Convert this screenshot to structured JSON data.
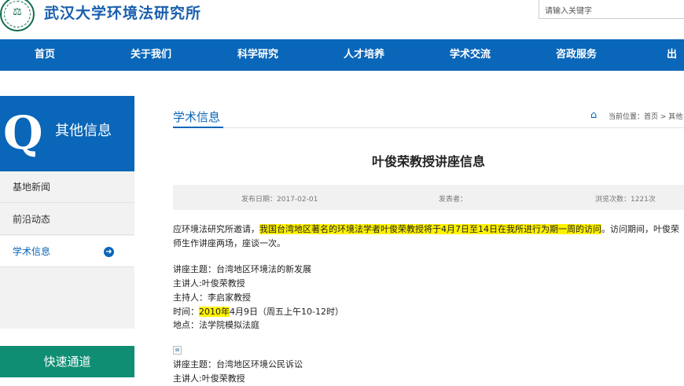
{
  "header": {
    "site_title": "武汉大学环境法研究所",
    "search_placeholder": "请输入关键字",
    "logo_icon": "university-seal-icon"
  },
  "nav": {
    "items": [
      "首页",
      "关于我们",
      "科学研究",
      "人才培养",
      "学术交流",
      "咨政服务",
      "出版"
    ]
  },
  "sidebar": {
    "head_letter": "Q",
    "title": "其他信息",
    "items": [
      {
        "label": "基地新闻",
        "active": false
      },
      {
        "label": "前沿动态",
        "active": false
      },
      {
        "label": "学术信息",
        "active": true
      }
    ],
    "quick_title": "快速通道"
  },
  "main": {
    "section_title": "学术信息",
    "breadcrumb": "当前位置：首页 > 其他",
    "article_title": "叶俊荣教授讲座信息",
    "meta": {
      "date": "发布日期：2017-02-01",
      "author": "发表者：",
      "views": "浏览次数：1221次"
    },
    "intro_a": "应环境法研究所邀请，",
    "intro_b": "我国台湾地区著名的环境法学者叶俊荣教授将于4月7日至14日在我所进行为期一周的访问",
    "intro_c": "。访问期间，叶俊荣",
    "intro_line2": "师生作讲座两场，座谈一次。",
    "lecture1": {
      "topic": "讲座主题：台湾地区环境法的新发展",
      "speaker": "主讲人:叶俊荣教授",
      "host": "主持人：李启家教授",
      "time_prefix": "时间：",
      "time_year": "2010年",
      "time_rest": "4月9日（周五上午10-12时）",
      "place": "地点：法学院模拟法庭"
    },
    "lecture2": {
      "topic": "讲座主题：台湾地区环境公民诉讼",
      "speaker": "主讲人:叶俊荣教授"
    }
  },
  "colors": {
    "brand_blue": "#0a66b8",
    "quick_green": "#0f8e74",
    "highlight": "#fff200"
  }
}
